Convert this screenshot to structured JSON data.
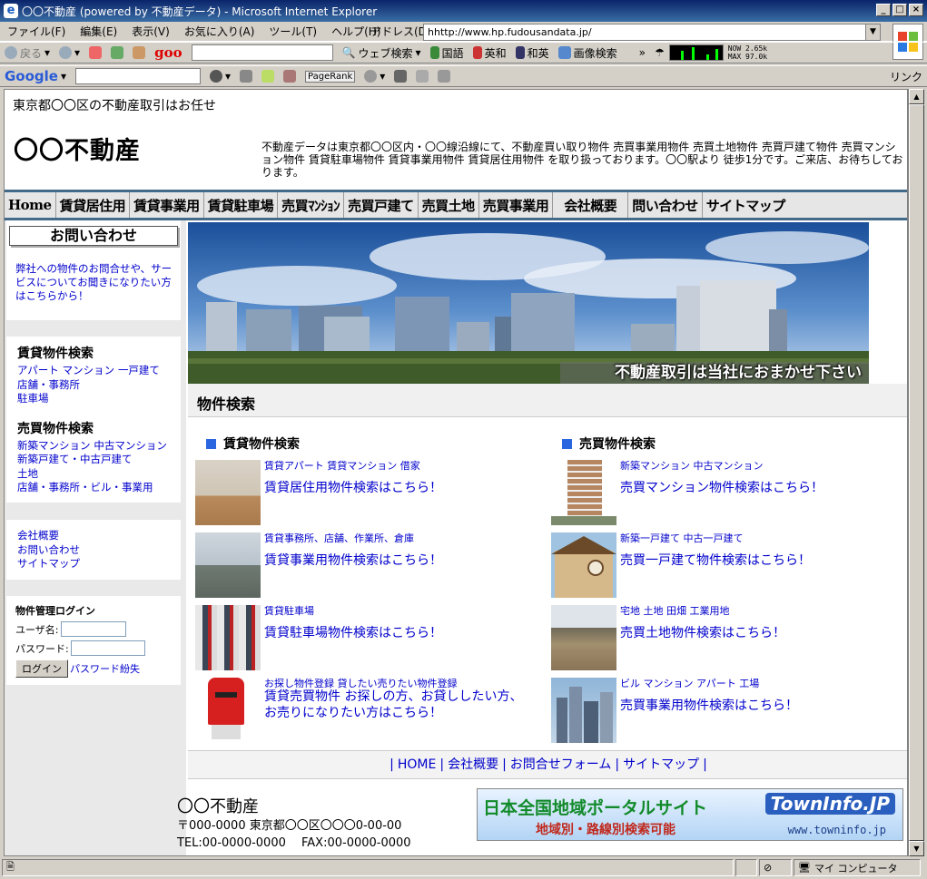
{
  "window": {
    "title": "〇〇不動産 (powered by 不動産データ) - Microsoft Internet Explorer"
  },
  "menu": [
    "ファイル(F)",
    "編集(E)",
    "表示(V)",
    "お気に入り(A)",
    "ツール(T)",
    "ヘルプ(H)"
  ],
  "address": {
    "label": "アドレス(D)",
    "url": "hhttp://www.hp.fudousandata.jp/"
  },
  "toolbar1": {
    "back": "戻る",
    "goo": "goo",
    "web_search": "ウェブ検索",
    "kokugo": "国語",
    "eiwa": "英和",
    "waei": "和英",
    "image_search": "画像検索",
    "speed_now": "NOW 2.65k",
    "speed_max": "MAX 97.0k"
  },
  "toolbar2": {
    "google": "Google",
    "pagerank": "PageRank",
    "links": "リンク"
  },
  "header": {
    "tagline": "東京都〇〇区の不動産取引はお任せ",
    "logo": "〇〇不動産",
    "description": "不動産データは東京都〇〇区内・〇〇線沿線にて、不動産買い取り物件 売買事業用物件 売買土地物件 売買戸建て物件 売買マンション物件 賃貸駐車場物件 賃貸事業用物件 賃貸居住用物件 を取り扱っております。〇〇駅より 徒歩1分です。ご来店、お待ちしております。"
  },
  "nav": [
    "Home",
    "賃貸居住用",
    "賃貸事業用",
    "賃貸駐車場",
    "売買ﾏﾝｼｮﾝ",
    "売買戸建て",
    "売買土地",
    "売買事業用",
    "会社概要",
    "問い合わせ",
    "サイトマップ"
  ],
  "sidebar": {
    "contact_title": "お問い合わせ",
    "contact_text": "弊社への物件のお問合せや、サービスについてお聞きになりたい方はこちらから！",
    "rent_title": "賃貸物件検索",
    "rent_links": [
      "アパート",
      "マンション",
      "一戸建て",
      "店舗・事務所",
      "駐車場"
    ],
    "sale_title": "売買物件検索",
    "sale_links": [
      "新築マンション",
      "中古マンション",
      "新築戸建て・中古戸建て",
      "土地",
      "店舗・事務所・ビル・事業用"
    ],
    "info_links": [
      "会社概要",
      "お問い合わせ",
      "サイトマップ"
    ],
    "login_title": "物件管理ログイン",
    "user_label": "ユーザ名:",
    "pass_label": "パスワード:",
    "login_button": "ログイン",
    "forgot": "パスワード紛失"
  },
  "hero": {
    "caption": "不動産取引は当社におまかせ下さい"
  },
  "main": {
    "heading": "物件検索",
    "rent_title": "賃貸物件検索",
    "sale_title": "売買物件検索",
    "rent_items": [
      {
        "small": "賃貸アパート 賃貸マンション 借家",
        "big": "賃貸居住用物件検索はこちら！"
      },
      {
        "small": "賃貸事務所、店舗、作業所、倉庫",
        "big": "賃貸事業用物件検索はこちら！"
      },
      {
        "small": "賃貸駐車場",
        "big": "賃貸駐車場物件検索はこちら！"
      },
      {
        "small": "お探し物件登録 貸したい売りたい物件登録",
        "big": "賃貸売買物件 お探しの方、お貸ししたい方、",
        "big2": "お売りになりたい方はこちら！"
      }
    ],
    "sale_items": [
      {
        "small": "新築マンション 中古マンション",
        "big": "売買マンション物件検索はこちら！"
      },
      {
        "small": "新築一戸建て 中古一戸建て",
        "big": "売買一戸建て物件検索はこちら！"
      },
      {
        "small": "宅地 土地 田畑 工業用地",
        "big": "売買土地物件検索はこちら！"
      },
      {
        "small": "ビル マンション アパート 工場",
        "big": "売買事業用物件検索はこちら！"
      }
    ]
  },
  "footer": {
    "links": [
      "HOME",
      "会社概要",
      "お問合せフォーム",
      "サイトマップ"
    ],
    "company": "〇〇不動産",
    "address": "〒000-0000 東京都〇〇区〇〇〇0-00-00",
    "tel": "TEL:00-0000-0000　 FAX:00-0000-0000",
    "banner_title": "日本全国地域ポータルサイト",
    "banner_logo": "TownInfo.JP",
    "banner_sub": "地域別・路線別検索可能",
    "banner_url": "www.towninfo.jp"
  },
  "status": {
    "zone": "マイ コンピュータ"
  }
}
